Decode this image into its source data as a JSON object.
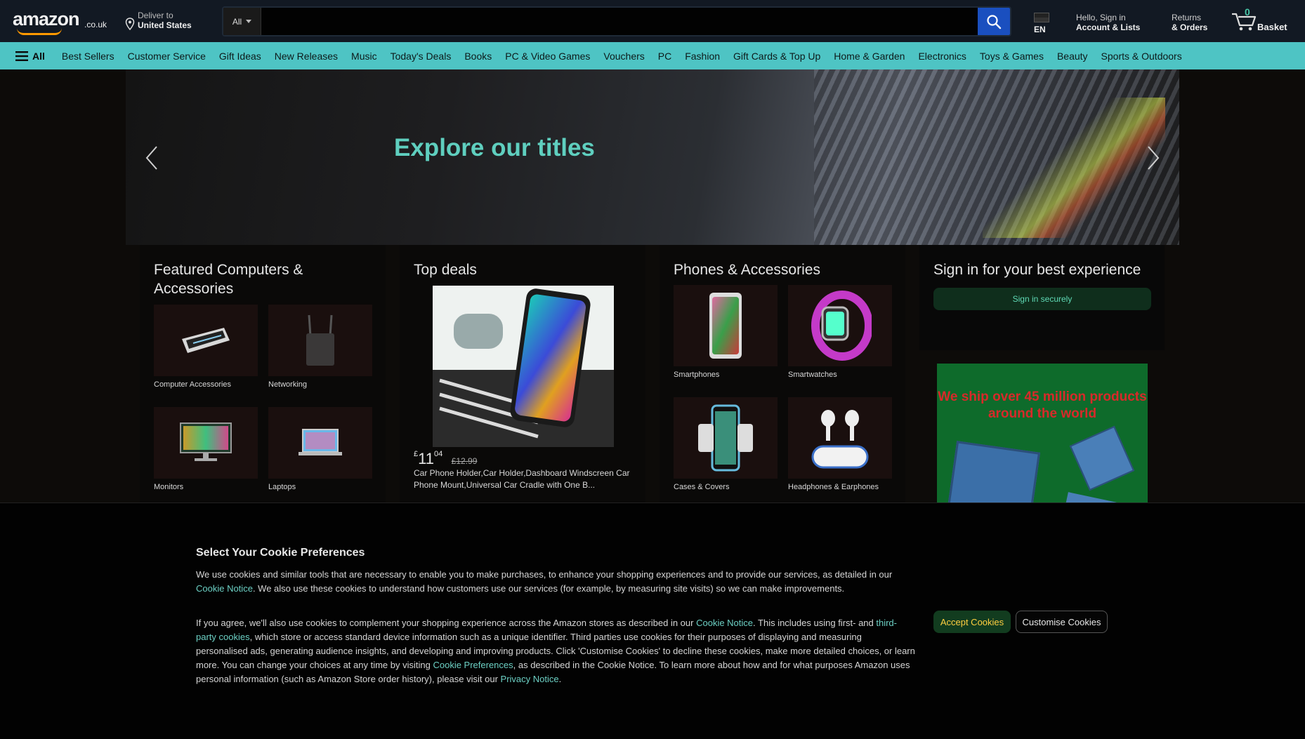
{
  "header": {
    "logo_text": "amazon",
    "logo_tld": ".co.uk",
    "deliver_line1": "Deliver to",
    "deliver_line2": "United States",
    "search_category": "All",
    "search_placeholder": "",
    "language": "EN",
    "account_line1": "Hello, Sign in",
    "account_line2": "Account & Lists",
    "returns_line1": "Returns",
    "returns_line2": "& Orders",
    "basket_count": "0",
    "basket_label": "Basket"
  },
  "nav": {
    "all_label": "All",
    "links": [
      "Best Sellers",
      "Customer Service",
      "Gift Ideas",
      "New Releases",
      "Music",
      "Today's Deals",
      "Books",
      "PC & Video Games",
      "Vouchers",
      "PC",
      "Fashion",
      "Gift Cards & Top Up",
      "Home & Garden",
      "Electronics",
      "Toys & Games",
      "Beauty",
      "Sports & Outdoors"
    ]
  },
  "hero": {
    "title": "Explore our titles"
  },
  "cards": {
    "computers": {
      "title": "Featured Computers & Accessories",
      "tiles": [
        "Computer Accessories",
        "Networking",
        "Monitors",
        "Laptops"
      ]
    },
    "deals": {
      "title": "Top deals",
      "price_symbol": "£",
      "price_whole": "11",
      "price_fraction": "04",
      "price_was": "£12.99",
      "description": "Car Phone Holder,Car Holder,Dashboard Windscreen Car Phone Mount,Universal Car Cradle with One B..."
    },
    "phones": {
      "title": "Phones & Accessories",
      "tiles": [
        "Smartphones",
        "Smartwatches",
        "Cases & Covers",
        "Headphones & Earphones"
      ]
    },
    "signin": {
      "title": "Sign in for your best experience",
      "button": "Sign in securely"
    },
    "ad": {
      "text": "We ship over 45 million products around the world"
    }
  },
  "cookie": {
    "title": "Select Your Cookie Preferences",
    "p1_a": "We use cookies and similar tools that are necessary to enable you to make purchases, to enhance your shopping experiences and to provide our services, as detailed in our ",
    "p1_link": "Cookie Notice",
    "p1_b": ". We also use these cookies to understand how customers use our services (for example, by measuring site visits) so we can make improvements.",
    "p2_a": "If you agree, we'll also use cookies to complement your shopping experience across the Amazon stores as described in our ",
    "p2_link1": "Cookie Notice",
    "p2_b": ". This includes using first- and ",
    "p2_link2": "third-party cookies",
    "p2_c": ", which store or access standard device information such as a unique identifier. Third parties use cookies for their purposes of displaying and measuring personalised ads, generating audience insights, and developing and improving products. Click 'Customise Cookies' to decline these cookies, make more detailed choices, or learn more. You can change your choices at any time by visiting ",
    "p2_link3": "Cookie Preferences",
    "p2_d": ", as described in the Cookie Notice. To learn more about how and for what purposes Amazon uses personal information (such as Amazon Store order history), please visit our ",
    "p2_link4": "Privacy Notice",
    "p2_e": ".",
    "accept_label": "Accept Cookies",
    "customise_label": "Customise Cookies"
  },
  "colors": {
    "header_bg": "#121923",
    "nav_bg": "#4ec4c4",
    "hero_title": "#5fcfbf",
    "search_button": "#1a4fbf",
    "accept_text": "#ffcf40",
    "link": "#6cd0c4",
    "ad_bg": "#0e6b2b",
    "ad_text": "#d8292a"
  }
}
